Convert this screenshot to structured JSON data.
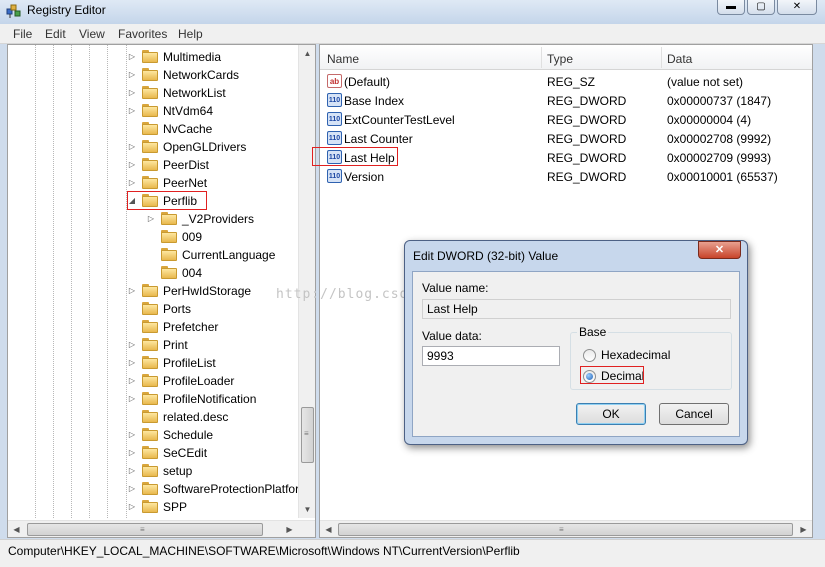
{
  "window": {
    "title": "Registry Editor",
    "icon": "registry-editor-icon",
    "controls": {
      "minimize": "▬",
      "maximize": "▢",
      "close": "✕"
    }
  },
  "menu": [
    "File",
    "Edit",
    "View",
    "Favorites",
    "Help"
  ],
  "tree": {
    "items": [
      {
        "label": "Multimedia",
        "expander": "▷"
      },
      {
        "label": "NetworkCards",
        "expander": "▷"
      },
      {
        "label": "NetworkList",
        "expander": "▷"
      },
      {
        "label": "NtVdm64",
        "expander": "▷"
      },
      {
        "label": "NvCache",
        "expander": ""
      },
      {
        "label": "OpenGLDrivers",
        "expander": "▷"
      },
      {
        "label": "PeerDist",
        "expander": "▷"
      },
      {
        "label": "PeerNet",
        "expander": "▷"
      },
      {
        "label": "Perflib",
        "expander": "◢",
        "selected": true
      },
      {
        "label": "_V2Providers",
        "expander": "▷",
        "child": true
      },
      {
        "label": "009",
        "expander": "",
        "child": true
      },
      {
        "label": "CurrentLanguage",
        "expander": "",
        "child": true
      },
      {
        "label": "004",
        "expander": "",
        "child": true
      },
      {
        "label": "PerHwIdStorage",
        "expander": "▷"
      },
      {
        "label": "Ports",
        "expander": ""
      },
      {
        "label": "Prefetcher",
        "expander": ""
      },
      {
        "label": "Print",
        "expander": "▷"
      },
      {
        "label": "ProfileList",
        "expander": "▷"
      },
      {
        "label": "ProfileLoader",
        "expander": "▷"
      },
      {
        "label": "ProfileNotification",
        "expander": "▷"
      },
      {
        "label": "related.desc",
        "expander": ""
      },
      {
        "label": "Schedule",
        "expander": "▷"
      },
      {
        "label": "SeCEdit",
        "expander": "▷"
      },
      {
        "label": "setup",
        "expander": "▷"
      },
      {
        "label": "SoftwareProtectionPlatform",
        "expander": "▷"
      },
      {
        "label": "SPP",
        "expander": "▷"
      }
    ]
  },
  "list": {
    "columns": [
      "Name",
      "Type",
      "Data"
    ],
    "rows": [
      {
        "name": "(Default)",
        "type": "REG_SZ",
        "data": "(value not set)",
        "icon": "ab",
        "icon_name": "string-value-icon"
      },
      {
        "name": "Base Index",
        "type": "REG_DWORD",
        "data": "0x00000737 (1847)",
        "icon": "110",
        "icon_name": "dword-value-icon"
      },
      {
        "name": "ExtCounterTestLevel",
        "type": "REG_DWORD",
        "data": "0x00000004 (4)",
        "icon": "110",
        "icon_name": "dword-value-icon"
      },
      {
        "name": "Last Counter",
        "type": "REG_DWORD",
        "data": "0x00002708 (9992)",
        "icon": "110",
        "icon_name": "dword-value-icon"
      },
      {
        "name": "Last Help",
        "type": "REG_DWORD",
        "data": "0x00002709 (9993)",
        "icon": "110",
        "icon_name": "dword-value-icon",
        "highlighted": true
      },
      {
        "name": "Version",
        "type": "REG_DWORD",
        "data": "0x00010001 (65537)",
        "icon": "110",
        "icon_name": "dword-value-icon"
      }
    ]
  },
  "dialog": {
    "title": "Edit DWORD (32-bit) Value",
    "close": "✕",
    "value_name_label": "Value name:",
    "value_name": "Last Help",
    "value_data_label": "Value data:",
    "value_data": "9993",
    "base_label": "Base",
    "hex_label": "Hexadecimal",
    "dec_label": "Decimal",
    "selected_base": "Decimal",
    "ok": "OK",
    "cancel": "Cancel"
  },
  "statusbar": "Computer\\HKEY_LOCAL_MACHINE\\SOFTWARE\\Microsoft\\Windows NT\\CurrentVersion\\Perflib",
  "watermark": "http://blog.csdn.net/fddqfddq",
  "scroll": {
    "up": "▲",
    "down": "▼",
    "left": "◀",
    "right": "▶",
    "grip": "≡"
  },
  "colors": {
    "highlight_box": "#e02020",
    "title_bg": "#c4d5ea",
    "close_button": "#c8442a"
  }
}
